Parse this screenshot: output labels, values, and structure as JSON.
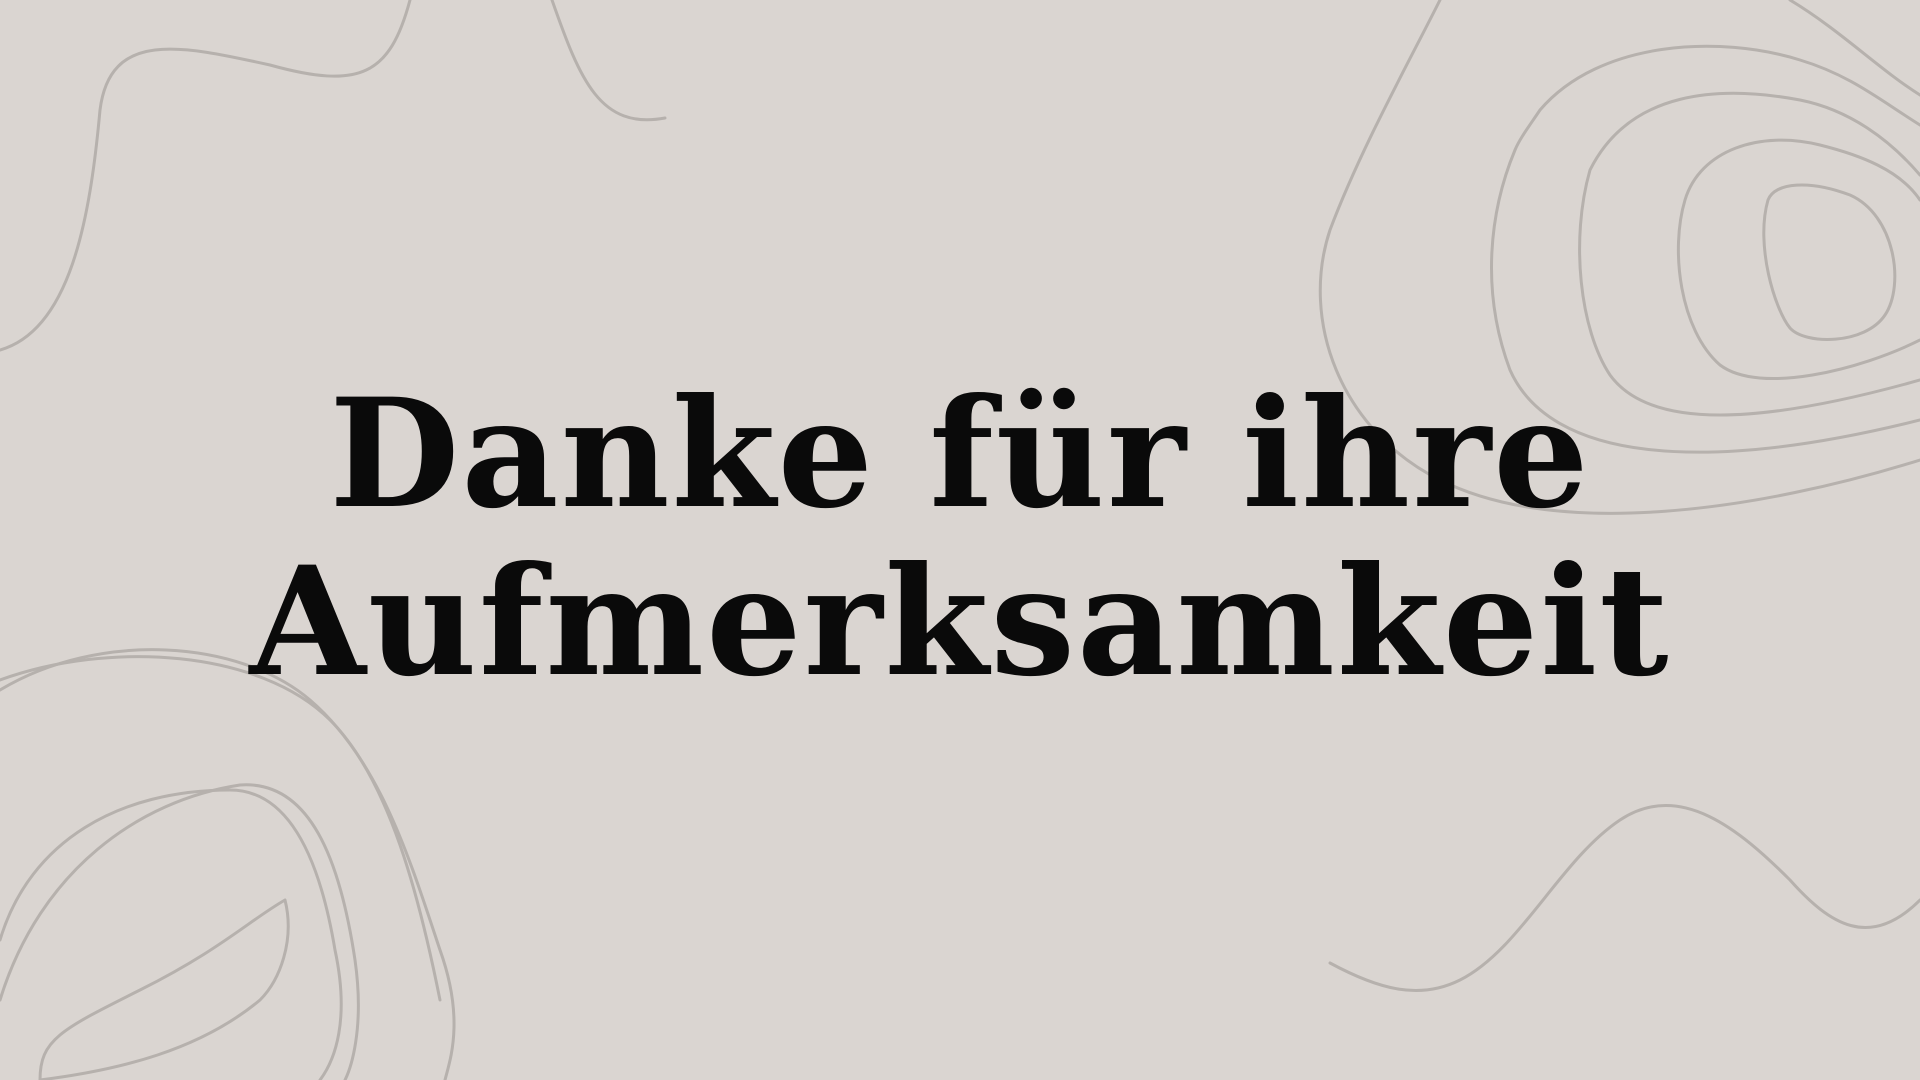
{
  "slide": {
    "background_color": "#dad5d1",
    "line_color": "#b6b1ad",
    "text_color": "#0a0a0a",
    "decoration": "topographic-contour-lines",
    "title_lines": [
      "Danke für ihre",
      "Aufmerksamkeit"
    ]
  }
}
